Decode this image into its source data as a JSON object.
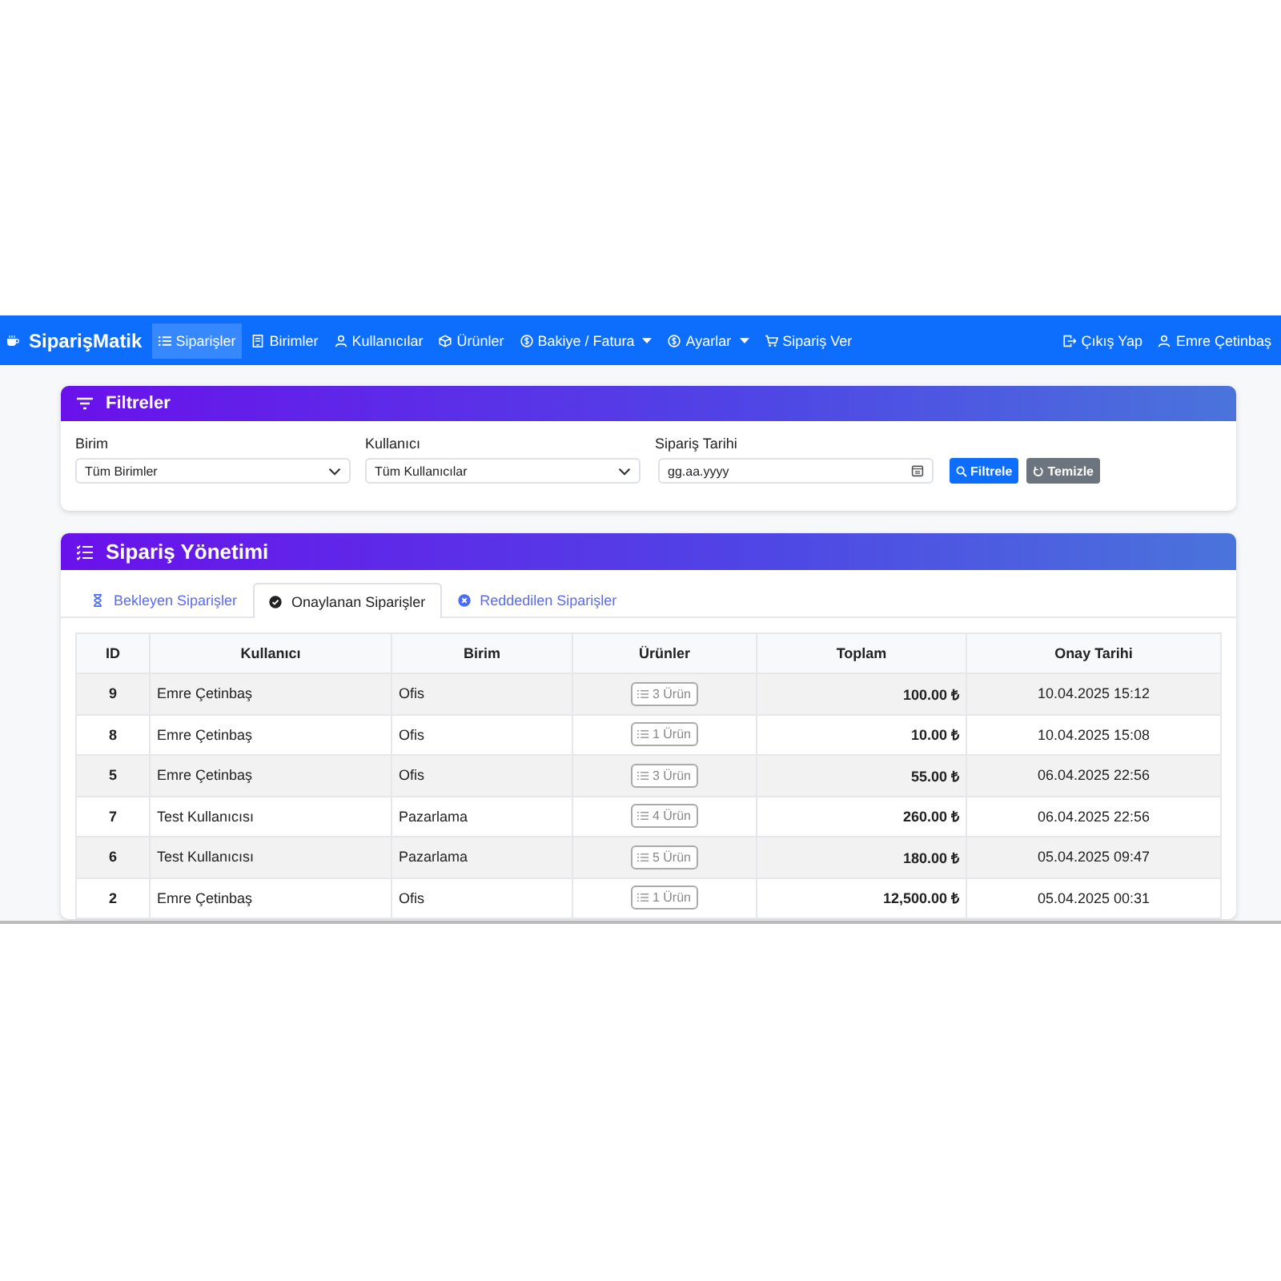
{
  "navbar": {
    "brand": "SiparişMatik",
    "items": [
      {
        "label": "Siparişler",
        "kind": "list",
        "selected": true,
        "dropdown": false
      },
      {
        "label": "Birimler",
        "kind": "building",
        "selected": false,
        "dropdown": false
      },
      {
        "label": "Kullanıcılar",
        "kind": "person",
        "selected": false,
        "dropdown": false
      },
      {
        "label": "Ürünler",
        "kind": "box",
        "selected": false,
        "dropdown": false
      },
      {
        "label": "Bakiye / Fatura",
        "kind": "coin",
        "selected": false,
        "dropdown": true
      },
      {
        "label": "Ayarlar",
        "kind": "coin",
        "selected": false,
        "dropdown": true
      },
      {
        "label": "Sipariş Ver",
        "kind": "cart",
        "selected": false,
        "dropdown": false
      }
    ],
    "right": [
      {
        "label": "Çıkış Yap",
        "kind": "logout"
      },
      {
        "label": "Emre Çetinbaş",
        "kind": "person"
      }
    ]
  },
  "filters": {
    "title": "Filtreler",
    "fields": [
      {
        "label": "Birim",
        "kind": "select",
        "value": "Tüm Birimler"
      },
      {
        "label": "Kullanıcı",
        "kind": "select",
        "value": "Tüm Kullanıcılar"
      },
      {
        "label": "Sipariş Tarihi",
        "kind": "date",
        "placeholder": "gg.aa.yyyy"
      }
    ],
    "buttons": [
      {
        "label": "Filtrele",
        "kind": "primary"
      },
      {
        "label": "Temizle",
        "kind": "secondary"
      }
    ]
  },
  "orders": {
    "title": "Sipariş Yönetimi",
    "tabs": [
      {
        "label": "Bekleyen Siparişler",
        "kind": "hourglass",
        "selected": false
      },
      {
        "label": "Onaylanan Siparişler",
        "kind": "check",
        "selected": true
      },
      {
        "label": "Reddedilen Siparişler",
        "kind": "cross",
        "selected": false
      }
    ],
    "table": {
      "columns": [
        "ID",
        "Kullanıcı",
        "Birim",
        "Ürünler",
        "Toplam",
        "Onay Tarihi"
      ],
      "rows": [
        {
          "id": "9",
          "user": "Emre Çetinbaş",
          "unit": "Ofis",
          "items": "3 Ürün",
          "total": "100.00 ₺",
          "date": "10.04.2025 15:12"
        },
        {
          "id": "8",
          "user": "Emre Çetinbaş",
          "unit": "Ofis",
          "items": "1 Ürün",
          "total": "10.00 ₺",
          "date": "10.04.2025 15:08"
        },
        {
          "id": "5",
          "user": "Emre Çetinbaş",
          "unit": "Ofis",
          "items": "3 Ürün",
          "total": "55.00 ₺",
          "date": "06.04.2025 22:56"
        },
        {
          "id": "7",
          "user": "Test Kullanıcısı",
          "unit": "Pazarlama",
          "items": "4 Ürün",
          "total": "260.00 ₺",
          "date": "06.04.2025 22:56"
        },
        {
          "id": "6",
          "user": "Test Kullanıcısı",
          "unit": "Pazarlama",
          "items": "5 Ürün",
          "total": "180.00 ₺",
          "date": "05.04.2025 09:47"
        },
        {
          "id": "2",
          "user": "Emre Çetinbaş",
          "unit": "Ofis",
          "items": "1 Ürün",
          "total": "12,500.00 ₺",
          "date": "05.04.2025 00:31"
        }
      ]
    }
  }
}
